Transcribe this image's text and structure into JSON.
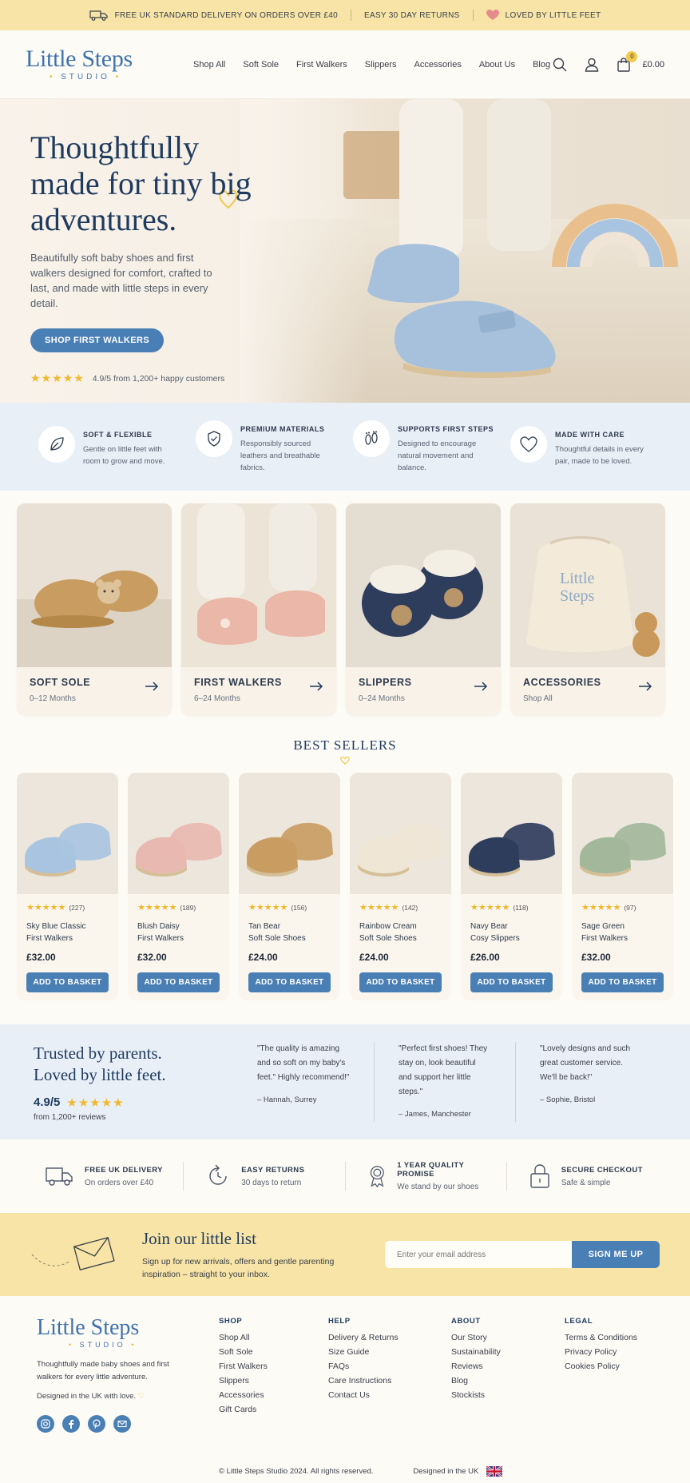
{
  "announcement": {
    "items": [
      "FREE UK STANDARD DELIVERY ON ORDERS OVER £40",
      "EASY 30 DAY RETURNS",
      "LOVED BY LITTLE FEET"
    ]
  },
  "brand": {
    "name": "Little Steps",
    "tagline": "STUDIO"
  },
  "nav": [
    "Shop All",
    "Soft Sole",
    "First Walkers",
    "Slippers",
    "Accessories",
    "About Us",
    "Blog"
  ],
  "cart": {
    "count": "0",
    "total": "£0.00"
  },
  "hero": {
    "title": "Thoughtfully made for tiny big adventures.",
    "subtitle": "Beautifully soft baby shoes and first walkers designed for comfort, crafted to last, and made with little steps in every detail.",
    "cta": "SHOP FIRST WALKERS",
    "rating_text": "4.9/5 from 1,200+ happy customers"
  },
  "features": [
    {
      "icon": "leaf-icon",
      "title": "SOFT & FLEXIBLE",
      "text": "Gentle on little feet with room to grow and move."
    },
    {
      "icon": "shield-check-icon",
      "title": "PREMIUM MATERIALS",
      "text": "Responsibly sourced leathers and breathable fabrics."
    },
    {
      "icon": "footprints-icon",
      "title": "SUPPORTS FIRST STEPS",
      "text": "Designed to encourage natural movement and balance."
    },
    {
      "icon": "heart-icon",
      "title": "MADE WITH CARE",
      "text": "Thoughtful details in every pair, made to be loved."
    }
  ],
  "categories": [
    {
      "name": "SOFT SOLE",
      "sub": "0–12 Months"
    },
    {
      "name": "FIRST WALKERS",
      "sub": "6–24 Months"
    },
    {
      "name": "SLIPPERS",
      "sub": "0–24 Months"
    },
    {
      "name": "ACCESSORIES",
      "sub": "Shop All"
    }
  ],
  "bestsellers": {
    "title": "BEST SELLERS",
    "add_label": "ADD TO BASKET",
    "products": [
      {
        "name": "Sky Blue Classic",
        "name2": "First Walkers",
        "price": "£32.00",
        "reviews": "(227)",
        "color": "#a9c4e0"
      },
      {
        "name": "Blush Daisy",
        "name2": "First Walkers",
        "price": "£32.00",
        "reviews": "(189)",
        "color": "#e8b9b0"
      },
      {
        "name": "Tan Bear",
        "name2": "Soft Sole Shoes",
        "price": "£24.00",
        "reviews": "(156)",
        "color": "#c99d62"
      },
      {
        "name": "Rainbow Cream",
        "name2": "Soft Sole Shoes",
        "price": "£24.00",
        "reviews": "(142)",
        "color": "#efe6d6"
      },
      {
        "name": "Navy Bear",
        "name2": "Cosy Slippers",
        "price": "£26.00",
        "reviews": "(118)",
        "color": "#2f3d5c"
      },
      {
        "name": "Sage Green",
        "name2": "First Walkers",
        "price": "£32.00",
        "reviews": "(97)",
        "color": "#a3b79a"
      }
    ]
  },
  "trust": {
    "title1": "Trusted by parents.",
    "title2": "Loved by little feet.",
    "score": "4.9/5",
    "count": "from 1,200+ reviews",
    "quotes": [
      {
        "text": "\"The quality is amazing and so soft on my baby's feet.\" Highly recommend!\"",
        "author": "– Hannah, Surrey"
      },
      {
        "text": "\"Perfect first shoes! They stay on, look beautiful and support her little steps.\"",
        "author": "– James, Manchester"
      },
      {
        "text": "\"Lovely designs and such great customer service. We'll be back!\"",
        "author": "– Sophie, Bristol"
      }
    ]
  },
  "perks": [
    {
      "title": "FREE UK DELIVERY",
      "text": "On orders over £40"
    },
    {
      "title": "EASY RETURNS",
      "text": "30 days to return"
    },
    {
      "title": "1 YEAR QUALITY PROMISE",
      "text": "We stand by our shoes"
    },
    {
      "title": "SECURE CHECKOUT",
      "text": "Safe & simple"
    }
  ],
  "newsletter": {
    "title": "Join our little list",
    "subtitle": "Sign up for new arrivals, offers and gentle parenting inspiration – straight to your inbox.",
    "placeholder": "Enter your email address",
    "button": "SIGN ME UP"
  },
  "footer": {
    "desc": "Thoughtfully made baby shoes and first walkers for every little adventure.",
    "love": "Designed in the UK with love.",
    "columns": [
      {
        "title": "SHOP",
        "links": [
          "Shop All",
          "Soft Sole",
          "First Walkers",
          "Slippers",
          "Accessories",
          "Gift Cards"
        ]
      },
      {
        "title": "HELP",
        "links": [
          "Delivery & Returns",
          "Size Guide",
          "FAQs",
          "Care Instructions",
          "Contact Us"
        ]
      },
      {
        "title": "ABOUT",
        "links": [
          "Our Story",
          "Sustainability",
          "Reviews",
          "Blog",
          "Stockists"
        ]
      },
      {
        "title": "LEGAL",
        "links": [
          "Terms & Conditions",
          "Privacy Policy",
          "Cookies Policy"
        ]
      }
    ],
    "copyright": "© Little Steps Studio 2024. All rights reserved.",
    "designed": "Designed in the UK"
  }
}
